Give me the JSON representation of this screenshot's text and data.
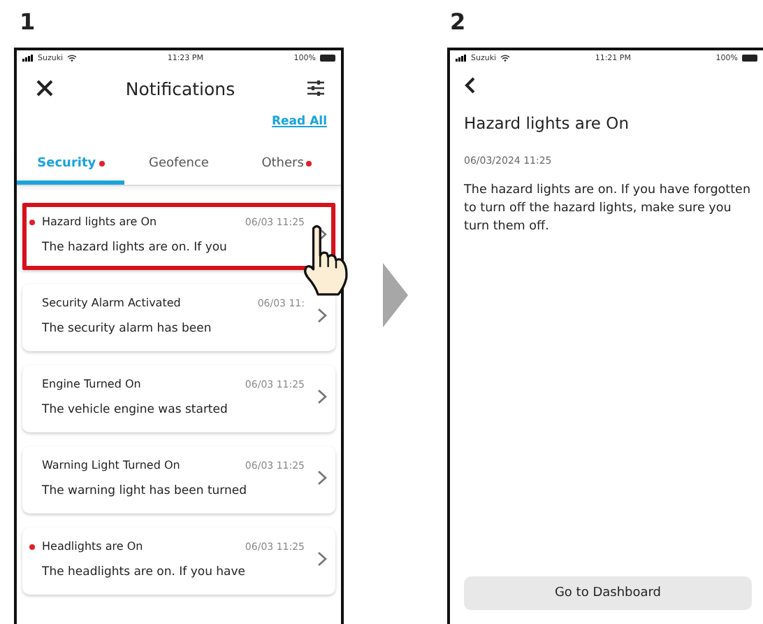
{
  "screen_1": {
    "step": "1",
    "status_bar": {
      "carrier": "Suzuki",
      "time": "11:23 PM",
      "battery": "100%"
    },
    "title": "Notifications",
    "read_all": "Read All",
    "tabs": [
      {
        "label": "Security",
        "selected": true,
        "unread": true
      },
      {
        "label": "Geofence",
        "selected": false,
        "unread": false
      },
      {
        "label": "Others",
        "selected": false,
        "unread": true
      }
    ],
    "notifications": [
      {
        "title": "Hazard lights are On",
        "date": "06/03 11:25",
        "preview": "The hazard lights are on. If you",
        "unread": true,
        "highlighted": true
      },
      {
        "title": "Security Alarm Activated",
        "date": "06/03 11:",
        "preview": "The security alarm has been",
        "unread": false,
        "highlighted": false
      },
      {
        "title": "Engine Turned On",
        "date": "06/03 11:25",
        "preview": "The vehicle engine was started",
        "unread": false,
        "highlighted": false
      },
      {
        "title": "Warning Light Turned On",
        "date": "06/03 11:25",
        "preview": "The warning light has been turned",
        "unread": false,
        "highlighted": false
      },
      {
        "title": "Headlights are On",
        "date": "06/03 11:25",
        "preview": "The headlights are on. If you have",
        "unread": true,
        "highlighted": false
      }
    ]
  },
  "screen_2": {
    "step": "2",
    "status_bar": {
      "carrier": "Suzuki",
      "time": "11:21 PM",
      "battery": "100%"
    },
    "title": "Hazard lights are On",
    "date": "06/03/2024 11:25",
    "body": "The hazard lights are on. If you have forgotten to turn off the hazard lights, make sure you turn them off.",
    "button": "Go to Dashboard"
  }
}
